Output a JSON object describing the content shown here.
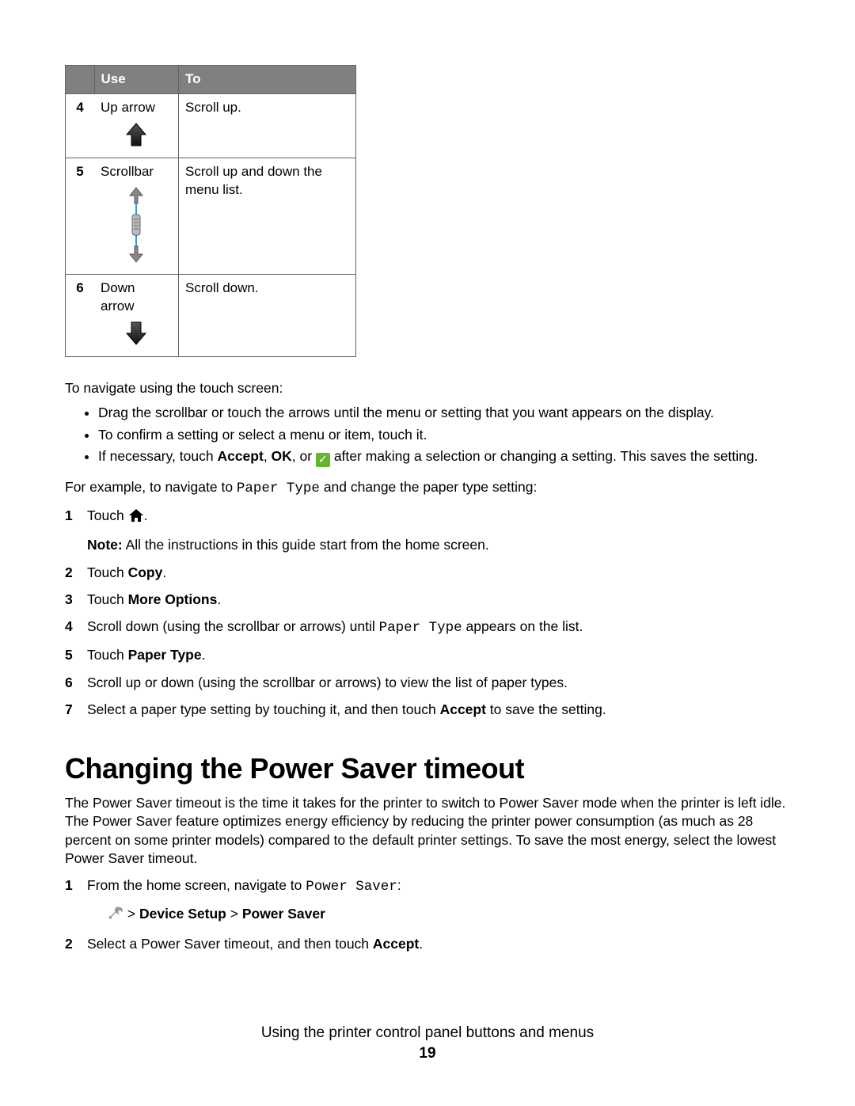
{
  "table": {
    "headers": {
      "use": "Use",
      "to": "To"
    },
    "rows": [
      {
        "n": "4",
        "use": "Up arrow",
        "to": "Scroll up."
      },
      {
        "n": "5",
        "use": "Scrollbar",
        "to": "Scroll up and down the menu list."
      },
      {
        "n": "6",
        "use": "Down arrow",
        "to": "Scroll down."
      }
    ]
  },
  "navIntro": "To navigate using the touch screen:",
  "bullets": {
    "b1": "Drag the scrollbar or touch the arrows until the menu or setting that you want appears on the display.",
    "b2": "To confirm a setting or select a menu or item, touch it.",
    "b3_pre": "If necessary, touch ",
    "b3_accept": "Accept",
    "b3_sep1": ", ",
    "b3_ok": "OK",
    "b3_sep2": ", or ",
    "b3_post": " after making a selection or changing a setting. This saves the setting."
  },
  "example": {
    "pre": "For example, to navigate to ",
    "code": "Paper Type",
    "post": " and change the paper type setting:"
  },
  "stepsA": {
    "s1_n": "1",
    "s1_pre": "Touch ",
    "s1_post": ".",
    "s1_note_label": "Note:",
    "s1_note_text": " All the instructions in this guide start from the home screen.",
    "s2_n": "2",
    "s2_pre": "Touch ",
    "s2_b": "Copy",
    "s2_post": ".",
    "s3_n": "3",
    "s3_pre": "Touch ",
    "s3_b": "More Options",
    "s3_post": ".",
    "s4_n": "4",
    "s4_pre": "Scroll down (using the scrollbar or arrows) until ",
    "s4_code": "Paper Type",
    "s4_post": " appears on the list.",
    "s5_n": "5",
    "s5_pre": "Touch ",
    "s5_b": "Paper Type",
    "s5_post": ".",
    "s6_n": "6",
    "s6_text": "Scroll up or down (using the scrollbar or arrows) to view the list of paper types.",
    "s7_n": "7",
    "s7_pre": "Select a paper type setting by touching it, and then touch ",
    "s7_b": "Accept",
    "s7_post": " to save the setting."
  },
  "heading": "Changing the Power Saver timeout",
  "psPara": "The Power Saver timeout is the time it takes for the printer to switch to Power Saver mode when the printer is left idle. The Power Saver feature optimizes energy efficiency by reducing the printer power consumption (as much as 28 percent on some printer models) compared to the default printer settings. To save the most energy, select the lowest Power Saver timeout.",
  "stepsB": {
    "s1_n": "1",
    "s1_pre": "From the home screen, navigate to ",
    "s1_code": "Power Saver",
    "s1_post": ":",
    "s1_path_sep1": " > ",
    "s1_path_a": "Device Setup",
    "s1_path_sep2": " > ",
    "s1_path_b": "Power Saver",
    "s2_n": "2",
    "s2_pre": "Select a Power Saver timeout, and then touch ",
    "s2_b": "Accept",
    "s2_post": "."
  },
  "footer": {
    "title": "Using the printer control panel buttons and menus",
    "page": "19"
  }
}
